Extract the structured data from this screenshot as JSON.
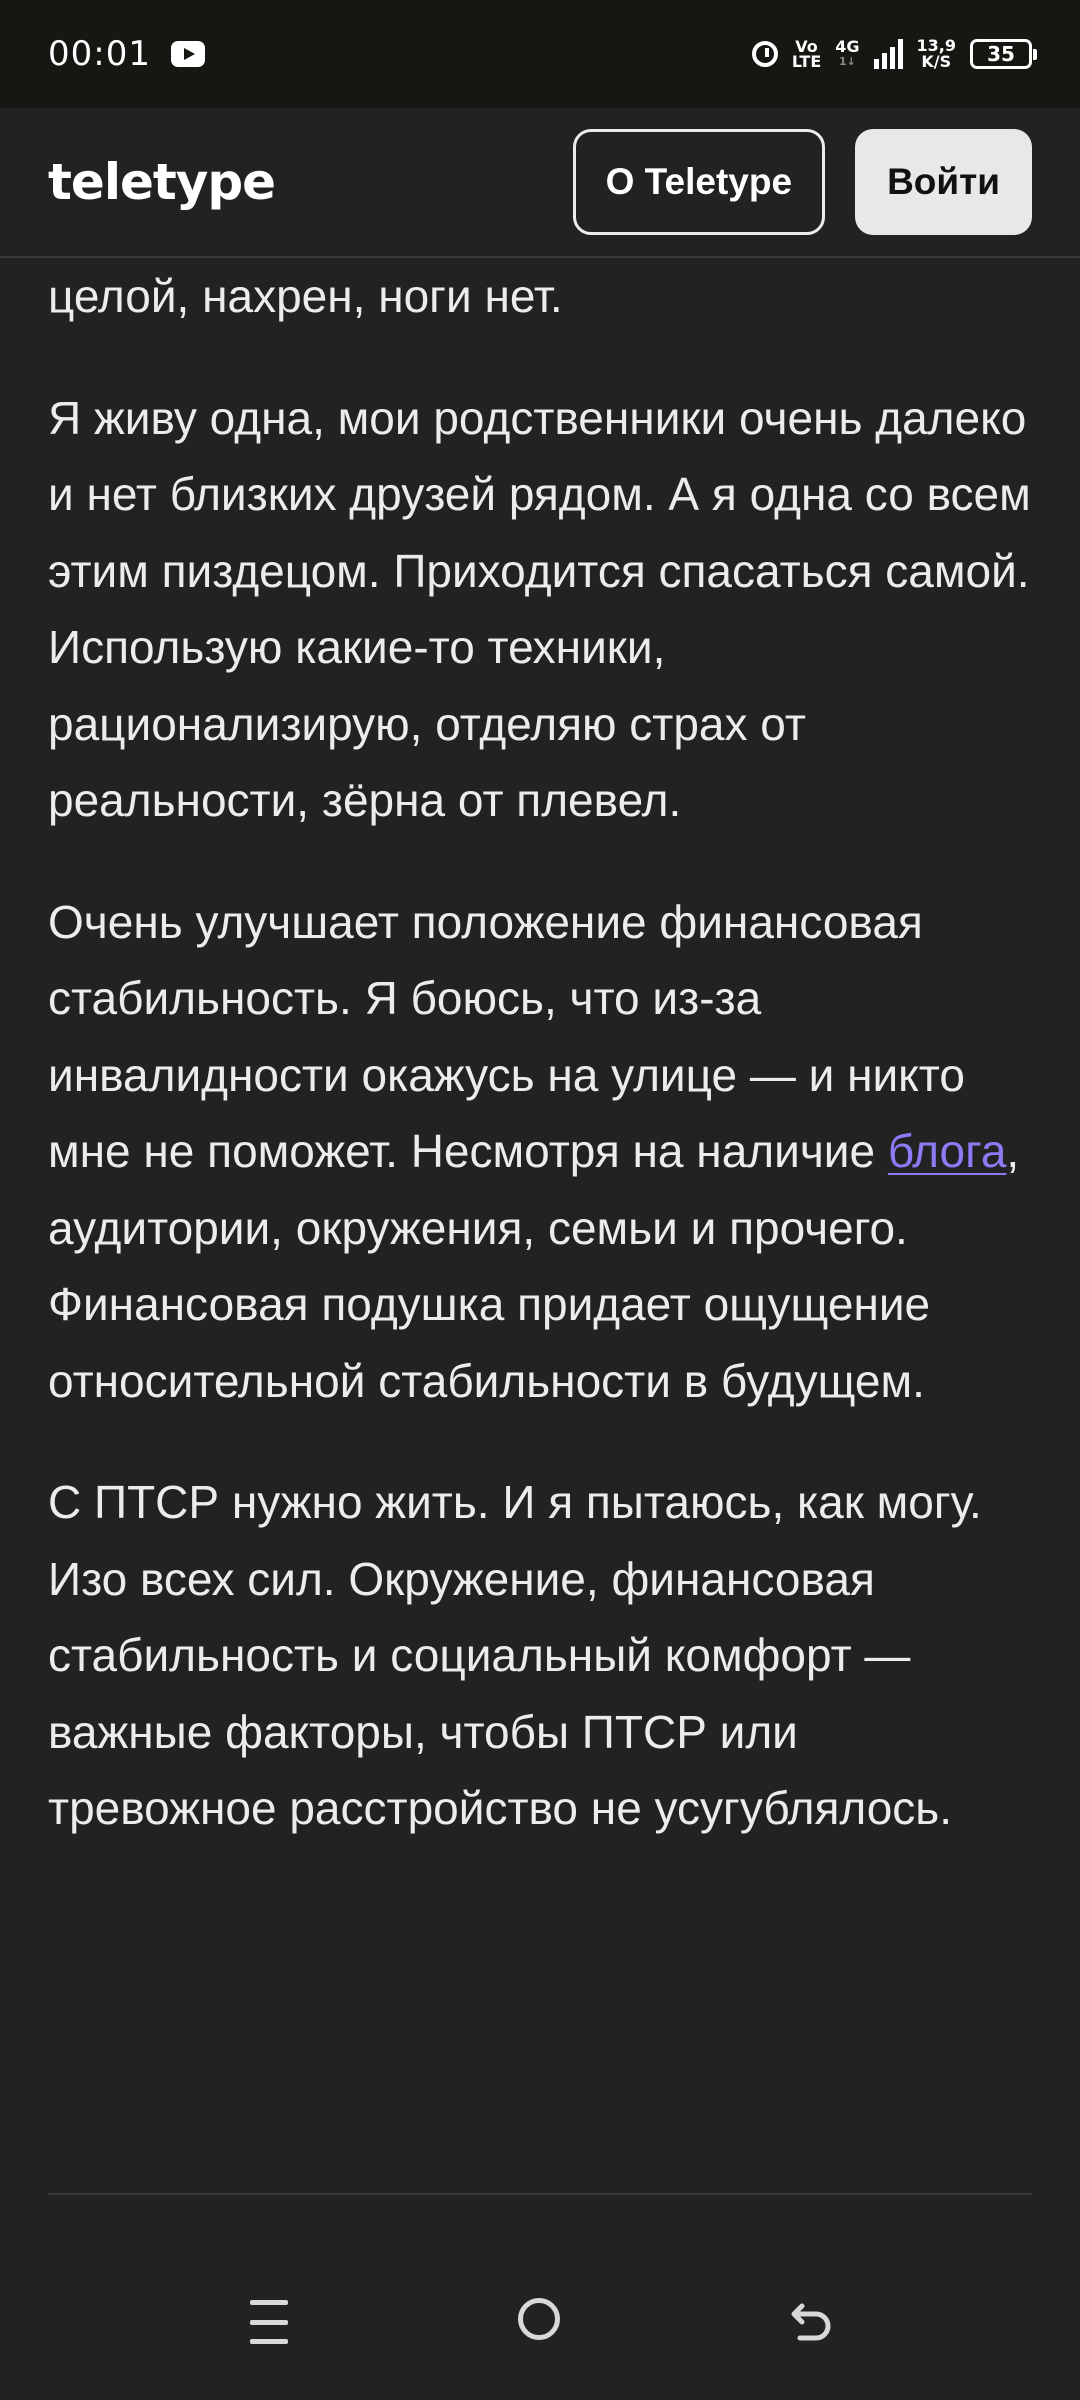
{
  "status_bar": {
    "time": "00:01",
    "volte_top": "Vo",
    "volte_bottom": "LTE",
    "network": "4G",
    "network_small": "1↓",
    "speed_value": "13,9",
    "speed_unit": "K/S",
    "battery": "35"
  },
  "header": {
    "logo": "teletype",
    "about_button": "О Teletype",
    "login_button": "Войти"
  },
  "article": {
    "p0": "целой, нахрен, ноги нет.",
    "p1": "Я живу одна, мои родственники очень далеко и нет близких друзей рядом. А я одна со всем этим пиздецом. Приходится спасаться самой. Использую какие-то техники, рационализирую, отделяю страх от реальности, зёрна от плевел.",
    "p2_before": "Очень улучшает положение финансовая стабильность. Я боюсь, что из-за инвалидности окажусь на улице — и никто мне не поможет. Несмотря на наличие ",
    "p2_link": "блога",
    "p2_after": ", аудитории, окружения, семьи и прочего. Финансовая подушка придает ощущение относительной стабильности в будущем.",
    "p3": "С ПТСР нужно жить. И я пытаюсь, как могу. Изо всех сил. Окружение, финансовая стабильность и социальный комфорт — важные факторы, чтобы ПТСР или тревожное расстройство не усугублялось."
  },
  "colors": {
    "background": "#222222",
    "link": "#8b7cf6",
    "text": "#ececec"
  }
}
